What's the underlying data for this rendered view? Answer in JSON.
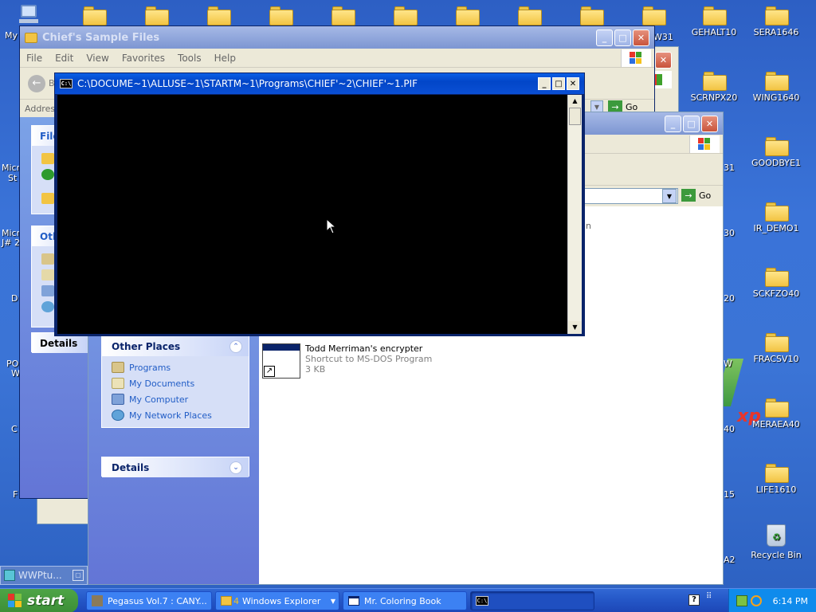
{
  "desktop": {
    "left_icons": [
      {
        "label": "My"
      }
    ],
    "folders": [
      {
        "label": "GEHALT10"
      },
      {
        "label": "SERA1646"
      },
      {
        "label": "SCRNPX20"
      },
      {
        "label": "WING1640"
      },
      {
        "label": "GOODBYE1"
      },
      {
        "label": "IR_DEMO1"
      },
      {
        "label": "SCKFZO40"
      },
      {
        "label": "FRACSV10"
      },
      {
        "label": "MERAEA40"
      },
      {
        "label": "LIFE1610"
      }
    ],
    "recycle_bin": "Recycle Bin",
    "partial_right_labels": [
      "W31",
      "31",
      "30",
      "20",
      "W",
      "40",
      "15",
      "A2"
    ],
    "partial_left_labels": [
      "M",
      "Micr",
      "St",
      "Micr",
      "J# 2",
      "D",
      "PO",
      "W",
      "C",
      "F"
    ]
  },
  "window_back": {
    "title": "Chief's Sample Files",
    "menu": [
      "File",
      "Edit",
      "View",
      "Favorites",
      "Tools",
      "Help"
    ],
    "address_label": "Addres",
    "back_letter": "B",
    "go_label": "Go",
    "pane_sections": [
      "File",
      "Oth",
      "Details"
    ]
  },
  "window_front": {
    "go_label": "Go",
    "other_places_title": "Other Places",
    "other_places": [
      "Programs",
      "My Documents",
      "My Computer",
      "My Network Places"
    ],
    "details_title": "Details",
    "file_item": {
      "name": "Todd Merriman's encrypter",
      "type": "Shortcut to MS-DOS Program",
      "size": "3 KB"
    },
    "partial_text": "n"
  },
  "console": {
    "title": "C:\\DOCUME~1\\ALLUSE~1\\STARTM~1\\Programs\\CHIEF'~2\\CHIEF'~1.PIF",
    "icon_label": "C:\\"
  },
  "minimized_tile": {
    "label": "WWPtu..."
  },
  "taskbar": {
    "start_label": "start",
    "buttons": [
      {
        "label": "Pegasus Vol.7 : CANY..."
      },
      {
        "label": "Windows Explorer",
        "count": "4"
      },
      {
        "label": "Mr. Coloring Book"
      },
      {
        "label": ""
      }
    ],
    "clock": "6:14 PM"
  },
  "colors": {
    "xp_blue": "#0a4fd4",
    "task_pane_link": "#215dc6",
    "console_bg": "#000000",
    "start_green": "#3c8f37"
  }
}
